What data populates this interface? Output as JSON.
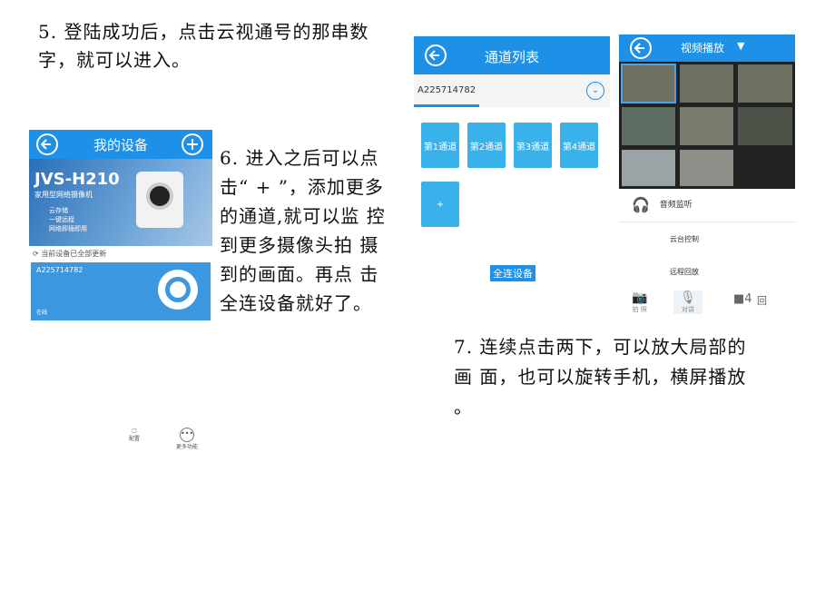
{
  "step5": {
    "line1": "5. 登陆成功后，点击云视通号的那串数",
    "line2": "字，就可以进入。"
  },
  "step6": {
    "lines": [
      "6.  进入之后可以点",
      "击“ + ”，添加更多",
      "的通道,就可以监 控",
      "到更多摄像头拍  摄",
      "到的画面。再点  击",
      "全连设备就好了。"
    ]
  },
  "step7": {
    "lines": [
      "7. 连续点击两下，可以放大局部的",
      "画  面，也可以旋转手机，横屏播放",
      "。"
    ]
  },
  "phone1": {
    "title": "我的设备",
    "banner_model": "JVS-H210",
    "banner_subtitle": "家用型网络摄像机",
    "banner_features": [
      "云存储",
      "一键远程",
      "网络即插即用"
    ],
    "update_status": "当前设备已全部更新",
    "device_id": "A225714782",
    "device_status": "在线",
    "bottom_labels": [
      "配置",
      "更多功能"
    ]
  },
  "phone2": {
    "title": "通道列表",
    "device_id": "A225714782",
    "channels": [
      "第1通道",
      "第2通道",
      "第3通道",
      "第4通道"
    ],
    "add_label": "+",
    "connect_all": "全连设备"
  },
  "phone3": {
    "title": "视频播放",
    "menu": [
      "音频监听",
      "云台控制",
      "远程回放"
    ],
    "bottom": {
      "photo": "拍 照",
      "talk": "对讲",
      "split": "■4",
      "back": "回"
    }
  }
}
